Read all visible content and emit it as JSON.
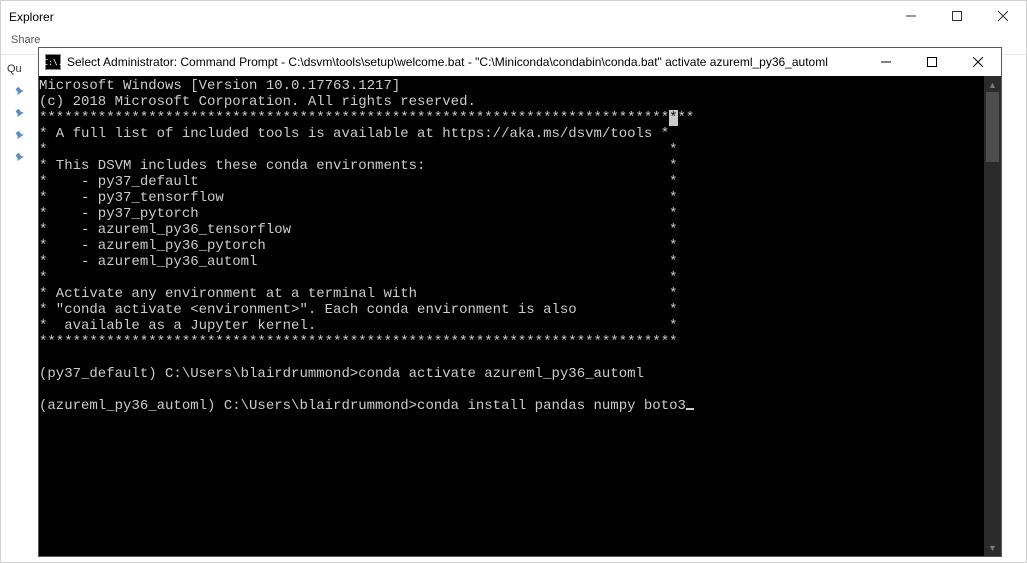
{
  "explorer": {
    "title": "Explorer",
    "tabs": {
      "share": "Share"
    },
    "qa_label": "Qu",
    "pins": [
      "pin",
      "pin",
      "pin",
      "pin"
    ]
  },
  "cmd": {
    "icon_text": "C:\\.",
    "title": "Select Administrator: Command Prompt - C:\\dsvm\\tools\\setup\\welcome.bat - \"C:\\Miniconda\\condabin\\conda.bat\"  activate azureml_py36_automl",
    "lines": [
      "Microsoft Windows [Version 10.0.17763.1217]",
      "(c) 2018 Microsoft Corporation. All rights reserved.",
      "",
      "* A full list of included tools is available at https://aka.ms/dsvm/tools *",
      "*                                                                          *",
      "* This DSVM includes these conda environments:                             *",
      "*    - py37_default                                                        *",
      "*    - py37_tensorflow                                                     *",
      "*    - py37_pytorch                                                        *",
      "*    - azureml_py36_tensorflow                                             *",
      "*    - azureml_py36_pytorch                                                *",
      "*    - azureml_py36_automl                                                 *",
      "*                                                                          *",
      "* Activate any environment at a terminal with                              *",
      "* \"conda activate <environment>\". Each conda environment is also           *",
      "*  available as a Jupyter kernel.                                          *",
      "",
      "",
      "(py37_default) C:\\Users\\blairdrummond>conda activate azureml_py36_automl",
      "",
      "(azureml_py36_automl) C:\\Users\\blairdrummond>conda install pandas numpy boto3"
    ],
    "star_row_leading": "***************************************************************************",
    "star_row_sel": "*",
    "star_row_trailing": "**",
    "star_row_full": "****************************************************************************"
  }
}
